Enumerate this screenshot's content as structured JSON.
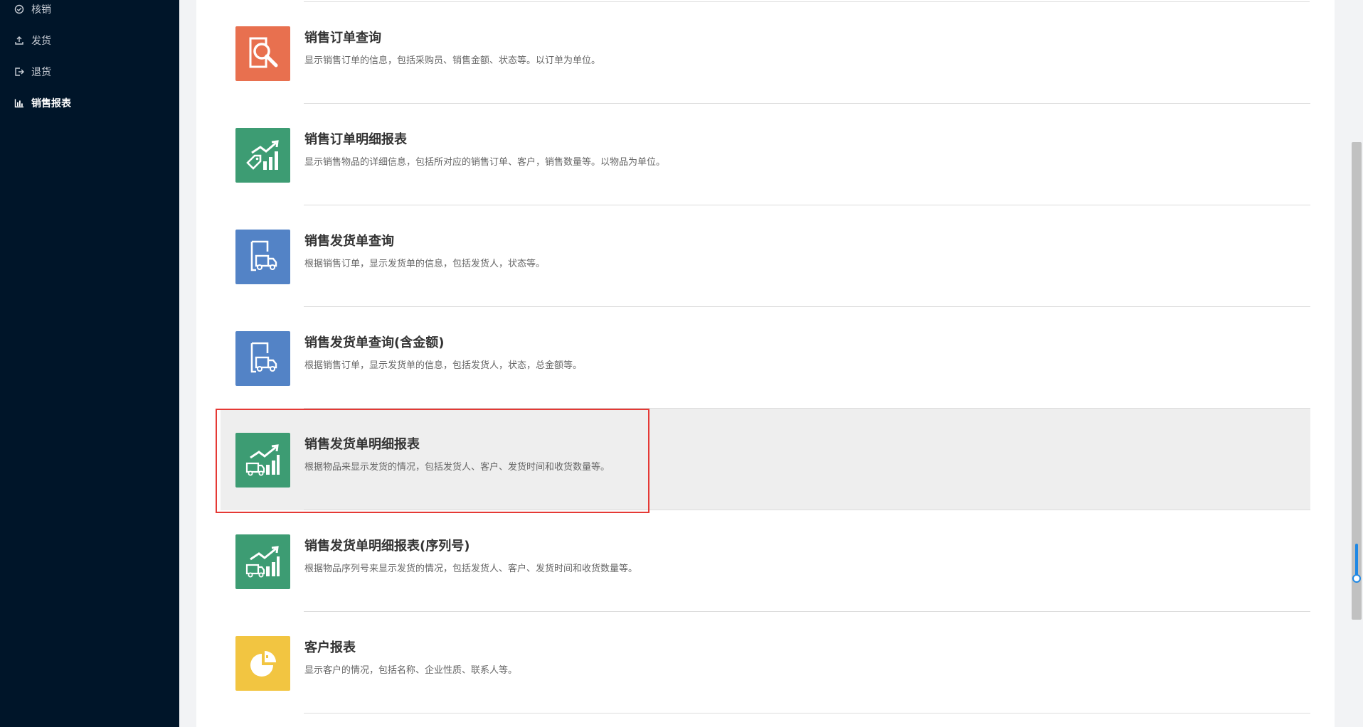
{
  "sidebar": {
    "items": [
      {
        "label": "核销",
        "icon": "check-circle-icon"
      },
      {
        "label": "发货",
        "icon": "upload-icon"
      },
      {
        "label": "退货",
        "icon": "logout-icon"
      },
      {
        "label": "销售报表",
        "icon": "bar-chart-icon",
        "active": true
      }
    ]
  },
  "reports": [
    {
      "title": "销售订单查询",
      "desc": "显示销售订单的信息，包括采购员、销售金额、状态等。以订单为单位。",
      "icon": "search-document-icon",
      "color": "#e8704f"
    },
    {
      "title": "销售订单明细报表",
      "desc": "显示销售物品的详细信息，包括所对应的销售订单、客户，销售数量等。以物品为单位。",
      "icon": "tag-growth-chart-icon",
      "color": "#3d9c73"
    },
    {
      "title": "销售发货单查询",
      "desc": "根据销售订单，显示发货单的信息，包括发货人，状态等。",
      "icon": "delivery-document-icon",
      "color": "#5383c6"
    },
    {
      "title": "销售发货单查询(含金额)",
      "desc": "根据销售订单，显示发货单的信息，包括发货人，状态，总金额等。",
      "icon": "delivery-document-icon",
      "color": "#5383c6"
    },
    {
      "title": "销售发货单明细报表",
      "desc": "根据物品来显示发货的情况，包括发货人、客户、发货时间和收货数量等。",
      "icon": "truck-growth-chart-icon",
      "color": "#3d9c73",
      "highlighted": true
    },
    {
      "title": "销售发货单明细报表(序列号)",
      "desc": "根据物品序列号来显示发货的情况，包括发货人、客户、发货时间和收货数量等。",
      "icon": "truck-growth-chart-icon",
      "color": "#3d9c73"
    },
    {
      "title": "客户报表",
      "desc": "显示客户的情况，包括名称、企业性质、联系人等。",
      "icon": "pie-chart-icon",
      "color": "#f2c541"
    }
  ],
  "colors": {
    "sidebar_bg": "#001529",
    "highlight_border": "#e53935",
    "highlight_bg": "#eeeeee"
  }
}
